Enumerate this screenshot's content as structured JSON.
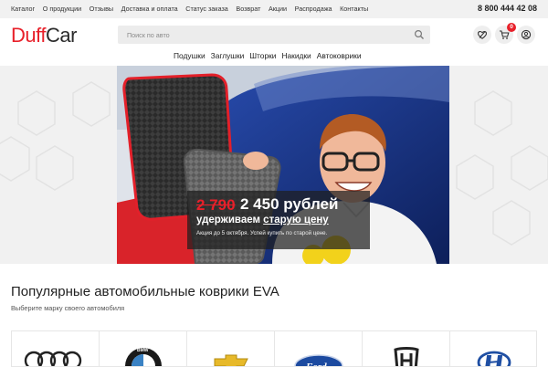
{
  "topbar": {
    "links": [
      "Каталог",
      "О продукции",
      "Отзывы",
      "Доставка и оплата",
      "Статус заказа",
      "Возврат",
      "Акции",
      "Распродажа",
      "Контакты"
    ],
    "phone": "8 800 444 42 08"
  },
  "header": {
    "logo_part1": "Duff",
    "logo_part2": "Car",
    "search_placeholder": "Поиск по авто",
    "cart_count": "0",
    "icons": [
      "search-icon",
      "favorites-icon",
      "cart-icon",
      "user-icon"
    ]
  },
  "catnav": [
    "Подушки",
    "Заглушки",
    "Шторки",
    "Накидки",
    "Автоковрики"
  ],
  "hero": {
    "old_price": "2 790",
    "new_price": "2 450 рублей",
    "line2_prefix": "удерживаем ",
    "line2_underlined": "старую цену",
    "line3": "Акция до 5 октября. Успей купить по старой цене."
  },
  "section": {
    "title": "Популярные автомобильные коврики EVA",
    "subtitle": "Выберите марку своего автомобиля",
    "brands": [
      "audi-logo",
      "bmw-logo",
      "chevrolet-logo",
      "ford-logo",
      "honda-logo",
      "hyundai-logo"
    ]
  },
  "colors": {
    "accent": "#e8202a",
    "topbar_bg": "#f1f1f1",
    "search_bg": "#ececec"
  }
}
